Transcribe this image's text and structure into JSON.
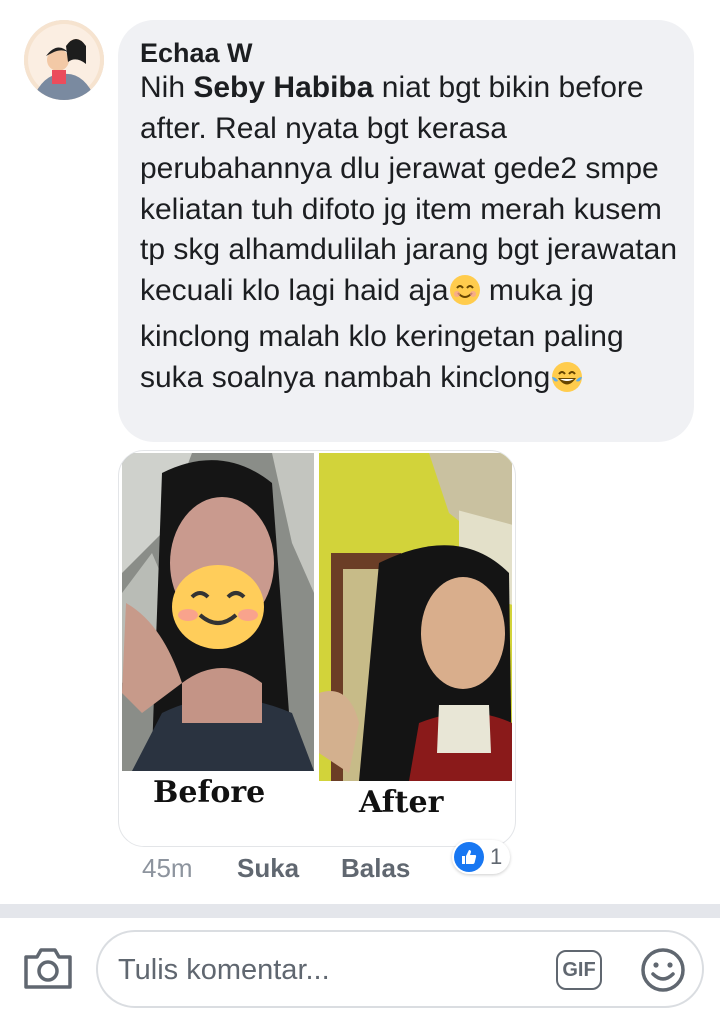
{
  "comment": {
    "author": "Echaa W",
    "text_before_mention": "Nih ",
    "mention": "Seby Habiba",
    "text_part1": " niat bgt bikin before after. Real nyata bgt kerasa perubahannya dlu jerawat gede2 smpe keliatan tuh difoto jg item merah kusem tp skg alhamdulilah jarang bgt jerawatan kecuali klo lagi haid aja",
    "text_part2": " muka jg kinclong malah klo keringetan paling suka soalnya nambah kinclong",
    "emoji1": "smiling-face-emoji",
    "emoji2": "tears-of-joy-emoji"
  },
  "photo": {
    "before_caption": "Before",
    "after_caption": "After"
  },
  "actions": {
    "time": "45m",
    "like": "Suka",
    "reply": "Balas",
    "reaction_count": "1"
  },
  "composer": {
    "placeholder": "Tulis komentar...",
    "gif_label": "GIF"
  },
  "colors": {
    "bubble": "#f0f1f4",
    "like_blue": "#1877f2",
    "muted": "#606770"
  }
}
